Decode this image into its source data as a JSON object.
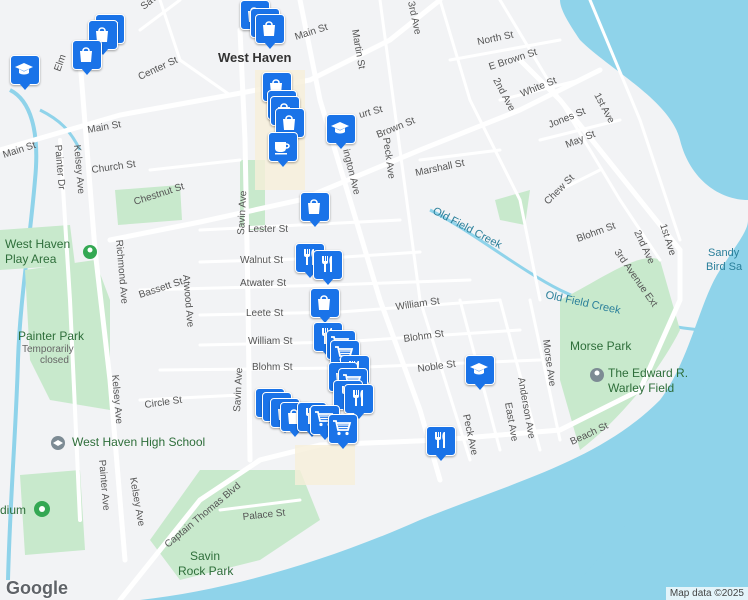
{
  "map": {
    "google_logo": "Google",
    "attribution": "Map data ©2025",
    "places": {
      "west_haven": "West Haven",
      "west_haven_play_area_1": "West Haven",
      "west_haven_play_area_2": "Play Area",
      "painter_park": "Painter Park",
      "painter_park_status_1": "Temporarily",
      "painter_park_status_2": "closed",
      "morse_park": "Morse Park",
      "warley_field_1": "The Edward R.",
      "warley_field_2": "Warley Field",
      "high_school": "West Haven High School",
      "savin_rock_park_1": "Savin",
      "savin_rock_park_2": "Rock Park",
      "sandy_bird_1": "Sandy",
      "sandy_bird_2": "Bird Sa",
      "stadium": "dium",
      "old_field_creek_1": "Old Field Creek",
      "old_field_creek_2": "Old Field Creek"
    },
    "streets": {
      "main_st_west": "Main St",
      "main_st_mid": "Main St",
      "main_st_north": "Main St",
      "elm": "Elm",
      "savin_ave_north": "Savin Ave",
      "center_st": "Center St",
      "church_st": "Church St",
      "chestnut_st": "Chestnut St",
      "painter_dr": "Painter Dr",
      "kelsey_ave_north": "Kelsey Ave",
      "richmond_ave": "Richmond Ave",
      "bassett_st": "Bassett St",
      "atwood_ave": "Atwood Ave",
      "savin_ave": "Savin Ave",
      "lester_st": "Lester St",
      "walnut_st": "Walnut St",
      "atwater_st": "Atwater St",
      "leete_st": "Leete St",
      "william_st_west": "William St",
      "blohm_st_west": "Blohm St",
      "circle_st": "Circle St",
      "kelsey_ave_south": "Kelsey Ave",
      "painter_ave": "Painter Ave",
      "kelsey_ave_far": "Kelsey Ave",
      "captain_thomas_blvd": "Captain Thomas Blvd",
      "palace_st": "Palace St",
      "martin_st": "Martin St",
      "brown_st": "Brown St",
      "court_st": "urt St",
      "washington_ave": "ington Ave",
      "peck_ave_north": "Peck Ave",
      "marshall_st": "Marshall St",
      "third_ave": "3rd Ave",
      "north_st": "North St",
      "e_brown_st": "E Brown St",
      "white_st": "White St",
      "second_ave_north": "2nd Ave",
      "jones_st": "Jones St",
      "first_ave_north": "1st Ave",
      "may_st": "May St",
      "chew_st": "Chew St",
      "blohm_st_east": "Blohm St",
      "second_ave_south": "2nd Ave",
      "first_ave_south": "1st Ave",
      "third_ave_ext": "3rd Avenue Ext",
      "william_st_east": "William St",
      "blohm_st_mid": "Blohm St",
      "noble_st": "Noble St",
      "morse_ave": "Morse Ave",
      "anderson_ave": "Anderson Ave",
      "east_ave": "East Ave",
      "peck_ave_south": "Peck Ave",
      "beach_st": "Beach St"
    },
    "marker_icons": [
      "shopping-bag-icon",
      "school-icon",
      "restaurant-icon",
      "shopping-cart-icon",
      "cafe-icon"
    ],
    "colors": {
      "water": "#8fd3ea",
      "park": "#c8e9cc",
      "road": "#ffffff",
      "marker": "#1a73e8"
    }
  }
}
